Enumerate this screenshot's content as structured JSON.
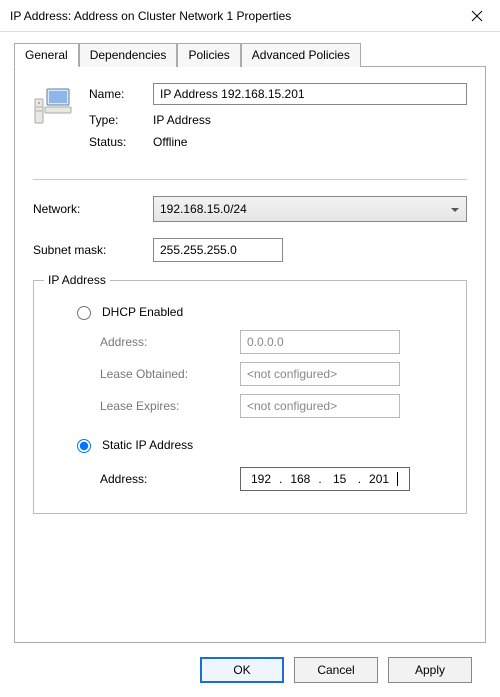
{
  "window": {
    "title": "IP Address: Address on Cluster Network 1 Properties"
  },
  "tabs": {
    "general": "General",
    "dependencies": "Dependencies",
    "policies": "Policies",
    "advanced": "Advanced Policies"
  },
  "general": {
    "name_label": "Name:",
    "name_value": "IP Address 192.168.15.201",
    "type_label": "Type:",
    "type_value": "IP Address",
    "status_label": "Status:",
    "status_value": "Offline",
    "network_label": "Network:",
    "network_value": "192.168.15.0/24",
    "subnet_label": "Subnet mask:",
    "subnet_value": "255.255.255.0"
  },
  "ip_group": {
    "title": "IP Address",
    "dhcp_label": "DHCP Enabled",
    "dhcp_address_label": "Address:",
    "dhcp_address_value": "0.0.0.0",
    "lease_obtained_label": "Lease Obtained:",
    "lease_obtained_value": "<not configured>",
    "lease_expires_label": "Lease Expires:",
    "lease_expires_value": "<not configured>",
    "static_label": "Static IP Address",
    "static_address_label": "Address:",
    "static_octets": {
      "a": "192",
      "b": "168",
      "c": "15",
      "d": "201"
    }
  },
  "buttons": {
    "ok": "OK",
    "cancel": "Cancel",
    "apply": "Apply"
  }
}
